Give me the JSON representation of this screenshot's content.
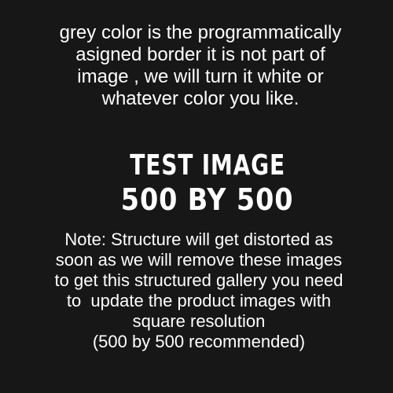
{
  "background_color": "#171717",
  "text_color": "#ffffff",
  "top_text": {
    "line_1": "grey color is the programmatically",
    "line_2": "asigned border it is not part of",
    "line_3": "image , we will turn it white or",
    "line_4": "whatever color you like."
  },
  "heading": {
    "line_1": "TEST IMAGE",
    "line_2": "500 BY 500"
  },
  "note": {
    "line_1": "Note: Structure will get distorted as",
    "line_2": "soon as we will remove these images",
    "line_3": "to get this structured gallery you need",
    "line_4": "to  update the product images with",
    "line_5": "square resolution",
    "line_6": "(500 by 500 recommended)"
  }
}
